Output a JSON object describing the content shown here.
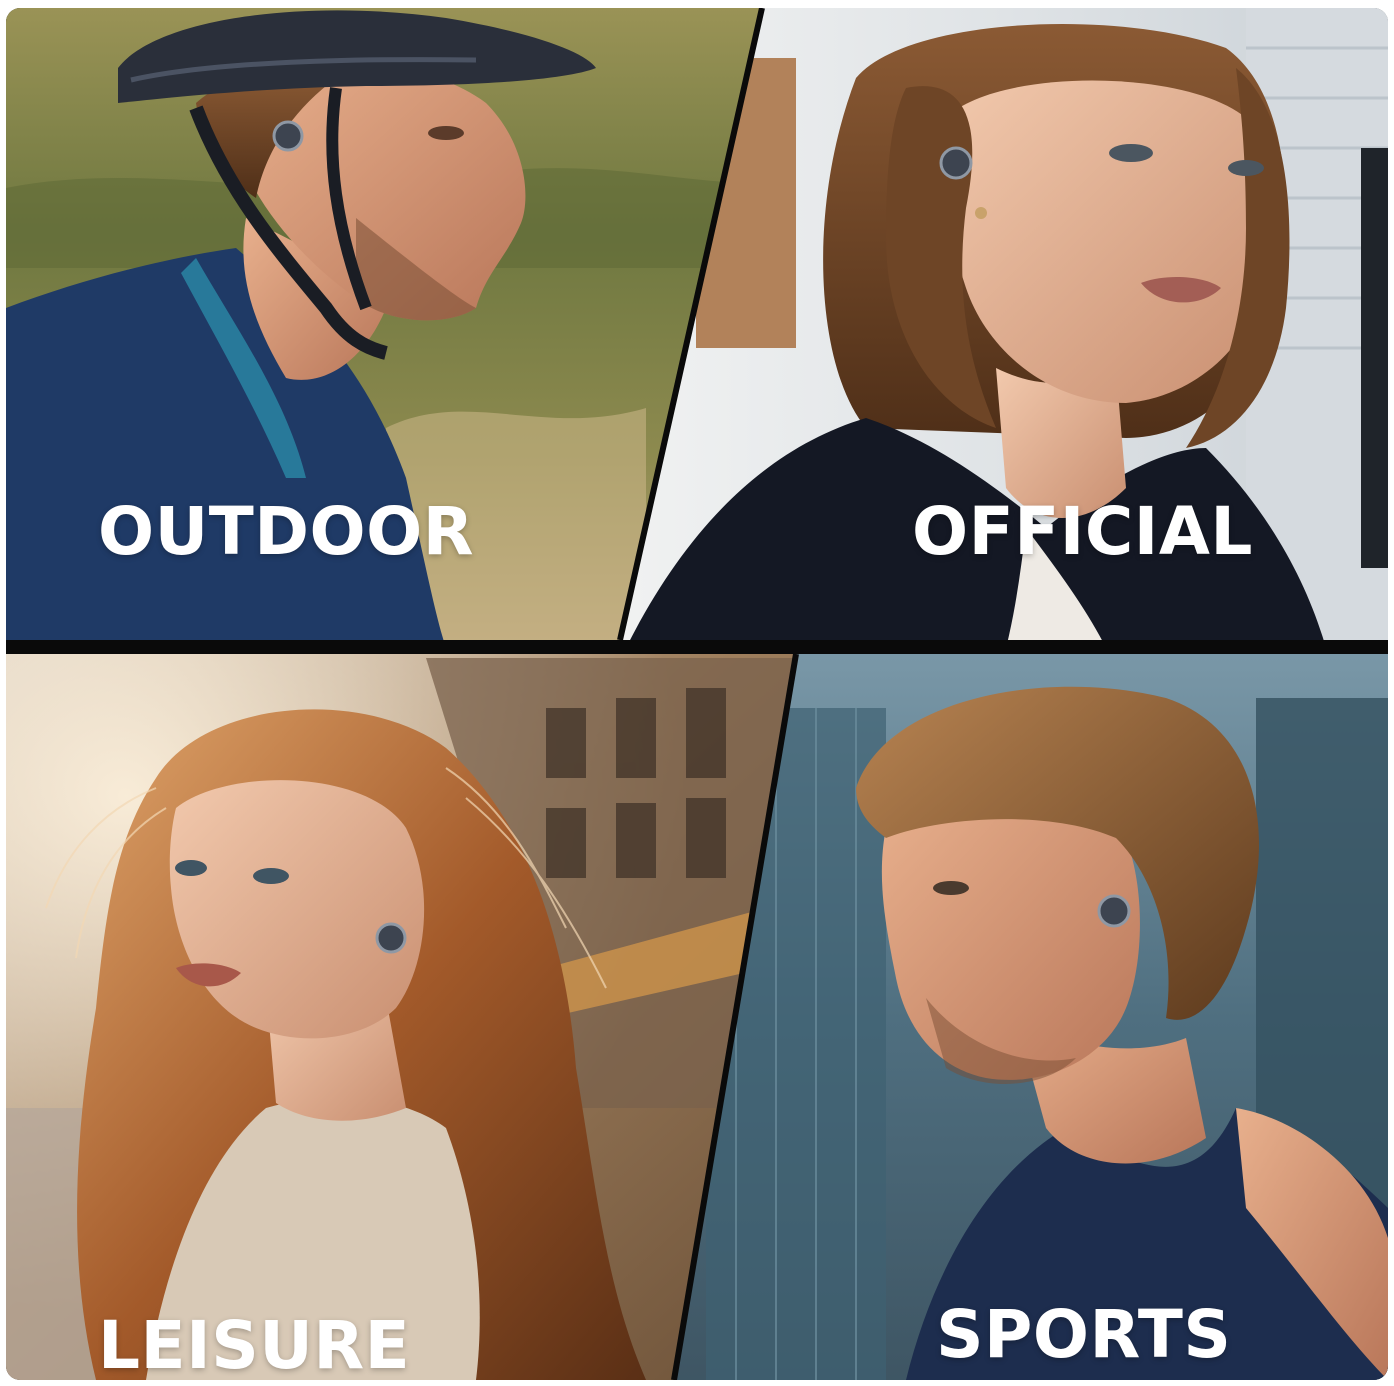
{
  "panels": [
    {
      "id": "outdoor",
      "label": "OUTDOOR"
    },
    {
      "id": "official",
      "label": "OFFICIAL"
    },
    {
      "id": "leisure",
      "label": "LEISURE"
    },
    {
      "id": "sports",
      "label": "SPORTS"
    }
  ],
  "colors": {
    "divider": "#0a0a0a",
    "label_text": "#ffffff",
    "outdoor_background": "#7d7a45",
    "outdoor_jersey": "#1f3a66",
    "official_background": "#e9ecee",
    "official_blazer": "#141824",
    "leisure_background": "#b79a78",
    "leisure_top": "#d8c9b6",
    "sports_background": "#5b7d8e",
    "sports_tank": "#1d2d4e"
  }
}
